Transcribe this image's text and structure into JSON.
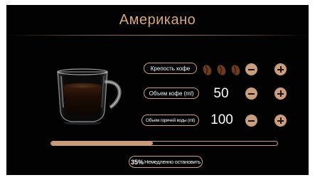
{
  "screen": {
    "title": "Американо"
  },
  "settings": {
    "strength": {
      "label": "Крепость кофе",
      "icon": "coffee-bean-icon"
    },
    "coffee_volume": {
      "label": "Объем кофе (ml)",
      "value": "50"
    },
    "water_volume": {
      "label": "Объем горячей воды (ml)",
      "value": "100"
    }
  },
  "progress": {
    "percent_label": "35%",
    "percent": 45,
    "stop_label": "Немедленно остановить"
  },
  "colors": {
    "background": "#020202",
    "accent": "#c99d7d",
    "title": "#d7a784"
  }
}
